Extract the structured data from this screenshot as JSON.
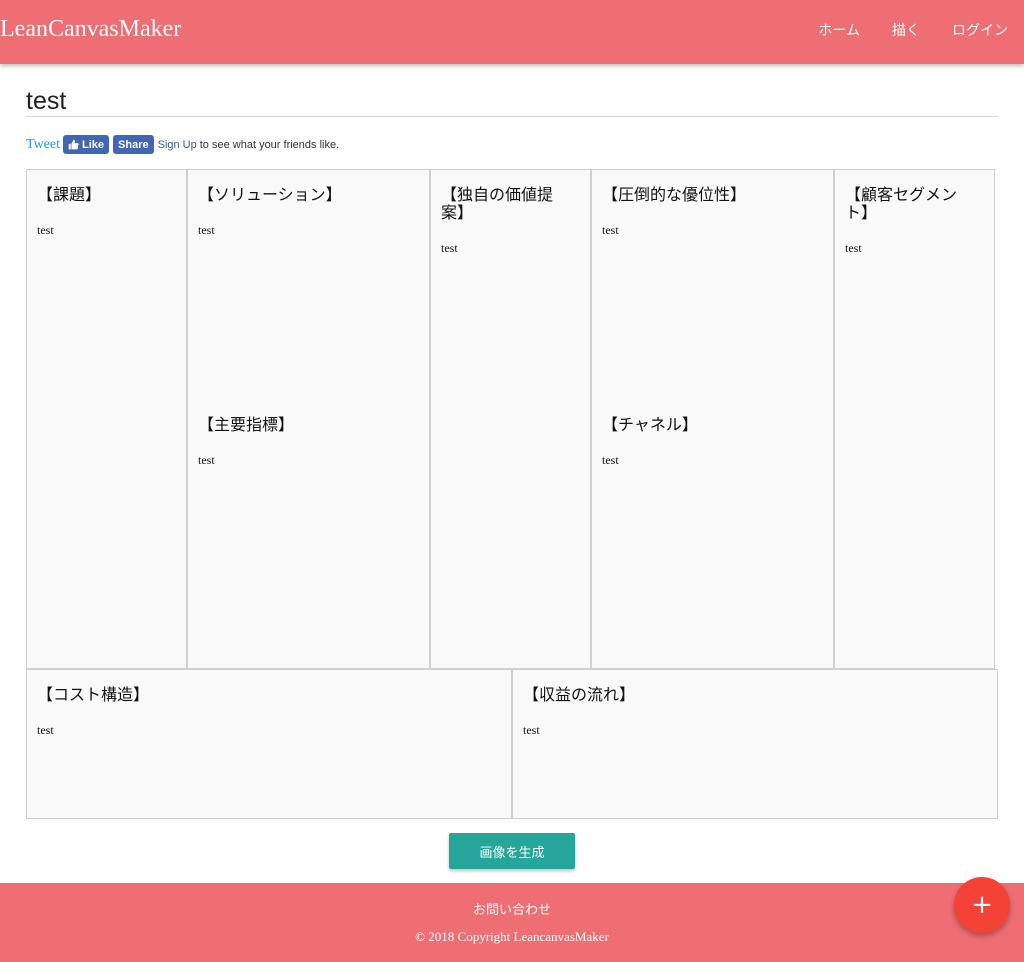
{
  "header": {
    "brand": "LeanCanvasMaker",
    "nav": [
      "ホーム",
      "描く",
      "ログイン"
    ]
  },
  "page": {
    "title": "test"
  },
  "social": {
    "tweet": "Tweet",
    "like": "Like",
    "share": "Share",
    "signup": "Sign Up",
    "friends_text": "to see what your friends like."
  },
  "canvas": {
    "problem": {
      "heading": "【課題】",
      "text": "test"
    },
    "solution": {
      "heading": "【ソリューション】",
      "text": "test"
    },
    "key_metrics": {
      "heading": "【主要指標】",
      "text": "test"
    },
    "uvp": {
      "heading": "【独自の価値提案】",
      "text": "test"
    },
    "unfair_advantage": {
      "heading": "【圧倒的な優位性】",
      "text": "test"
    },
    "channels": {
      "heading": "【チャネル】",
      "text": "test"
    },
    "customer_segments": {
      "heading": "【顧客セグメント】",
      "text": "test"
    },
    "cost_structure": {
      "heading": "【コスト構造】",
      "text": "test"
    },
    "revenue_streams": {
      "heading": "【収益の流れ】",
      "text": "test"
    }
  },
  "actions": {
    "generate_image": "画像を生成"
  },
  "footer": {
    "contact": "お問い合わせ",
    "copyright": "© 2018 Copyright LeancanvasMaker"
  },
  "fab": {
    "label": "+"
  },
  "colors": {
    "primary": "#ef6e73",
    "button": "#26a69a",
    "fab": "#f44336"
  }
}
